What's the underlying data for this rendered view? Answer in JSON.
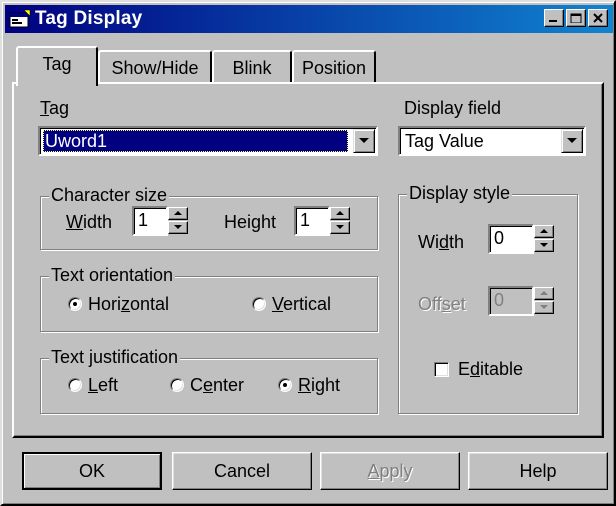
{
  "window": {
    "title": "Tag Display"
  },
  "tabs": [
    {
      "label": "Tag"
    },
    {
      "label": "Show/Hide"
    },
    {
      "label": "Blink"
    },
    {
      "label": "Position"
    }
  ],
  "tag": {
    "label_mnemonic": "T",
    "label_rest": "ag",
    "value": "Uword1"
  },
  "display_field": {
    "label": "Display field",
    "value": "Tag Value"
  },
  "character_size": {
    "legend": "Character size",
    "width": {
      "mn": "W",
      "rest": "idth",
      "value": "1"
    },
    "height": {
      "pre": "Hei",
      "mn": "g",
      "rest": "ht",
      "value": "1"
    }
  },
  "text_orientation": {
    "legend": "Text orientation",
    "horizontal": {
      "pre": "Hori",
      "mn": "z",
      "rest": "ontal",
      "selected": true
    },
    "vertical": {
      "mn": "V",
      "rest": "ertical",
      "selected": false
    }
  },
  "text_justification": {
    "legend": "Text justification",
    "left": {
      "mn": "L",
      "rest": "eft",
      "selected": false
    },
    "center": {
      "pre": "C",
      "mn": "e",
      "rest": "nter",
      "selected": false
    },
    "right": {
      "mn": "R",
      "rest": "ight",
      "selected": true
    }
  },
  "display_style": {
    "legend": "Display style",
    "width": {
      "pre": "Wi",
      "mn": "d",
      "rest": "th",
      "value": "0"
    },
    "offset": {
      "pre": "Off",
      "mn": "s",
      "rest": "et",
      "value": "0",
      "enabled": false
    },
    "editable": {
      "pre": "E",
      "mn": "d",
      "rest": "itable",
      "checked": false
    }
  },
  "buttons": {
    "ok": "OK",
    "cancel": "Cancel",
    "apply": {
      "mn": "A",
      "rest": "pply",
      "enabled": false
    },
    "help": "Help"
  },
  "colors": {
    "title_start": "#000080",
    "title_end": "#1084d0",
    "face": "#c0c0c0",
    "selection": "#000080"
  }
}
